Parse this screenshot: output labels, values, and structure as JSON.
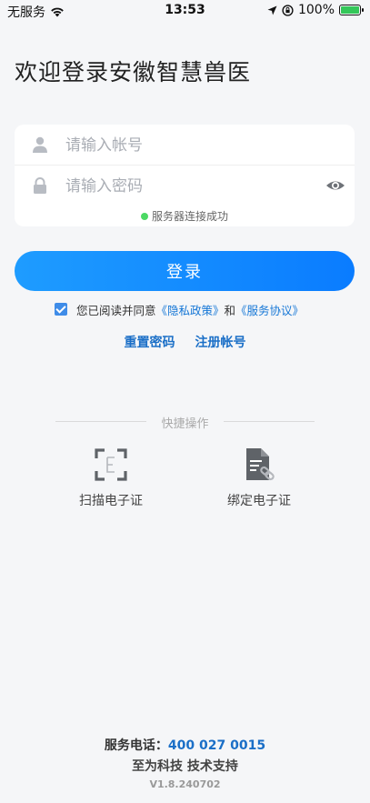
{
  "status_bar": {
    "carrier": "无服务",
    "time": "13:53",
    "battery": "100%"
  },
  "title": "欢迎登录安徽智慧兽医",
  "form": {
    "account_placeholder": "请输入帐号",
    "password_placeholder": "请输入密码",
    "server_status": "服务器连接成功"
  },
  "login_button": "登录",
  "agreement": {
    "prefix": "您已阅读并同意",
    "privacy_link": "《隐私政策》",
    "conjunction": "和",
    "service_link": "《服务协议》"
  },
  "links": {
    "reset_password": "重置密码",
    "register": "注册帐号"
  },
  "quick_actions": {
    "label": "快捷操作",
    "scan_label": "扫描电子证",
    "bind_label": "绑定电子证"
  },
  "footer": {
    "phone_label": "服务电话：",
    "phone_number": "400 027 0015",
    "support": "至为科技 技术支持",
    "version": "V1.8.240702"
  },
  "colors": {
    "primary": "#0a7cff",
    "link": "#1677d6",
    "success": "#4cd964"
  }
}
